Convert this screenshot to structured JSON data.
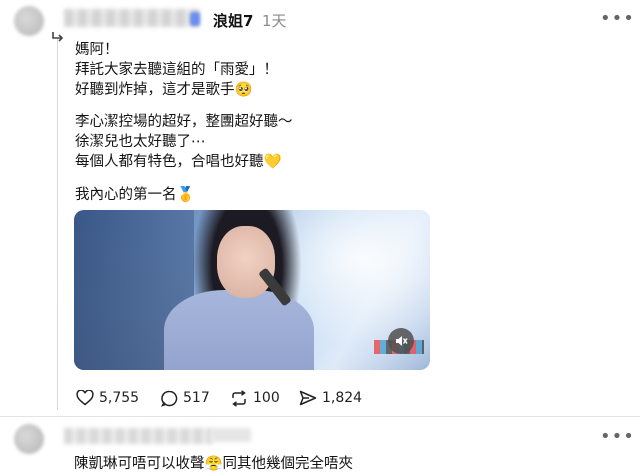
{
  "post": {
    "author_handle": "浪姐7",
    "time": "1天",
    "lines": [
      "媽阿！",
      "拜託大家去聽這組的「雨愛」！",
      "好聽到炸掉，這才是歌手🥺",
      "李心潔控場的超好，整團超好聽～",
      "徐潔兒也太好聽了⋯",
      "每個人都有特色，合唱也好聽💛",
      "我內心的第一名🥇"
    ]
  },
  "actions": {
    "likes": "5,755",
    "comments": "517",
    "reposts": "100",
    "shares": "1,824"
  },
  "reply": {
    "text": "陳凱琳可唔可以收聲😤同其他幾個完全唔夾"
  },
  "icons": {
    "like": "heart-icon",
    "comment": "comment-bubble-icon",
    "repost": "repost-icon",
    "share": "share-icon",
    "mute": "speaker-muted-icon",
    "more": "more-dots-icon"
  }
}
